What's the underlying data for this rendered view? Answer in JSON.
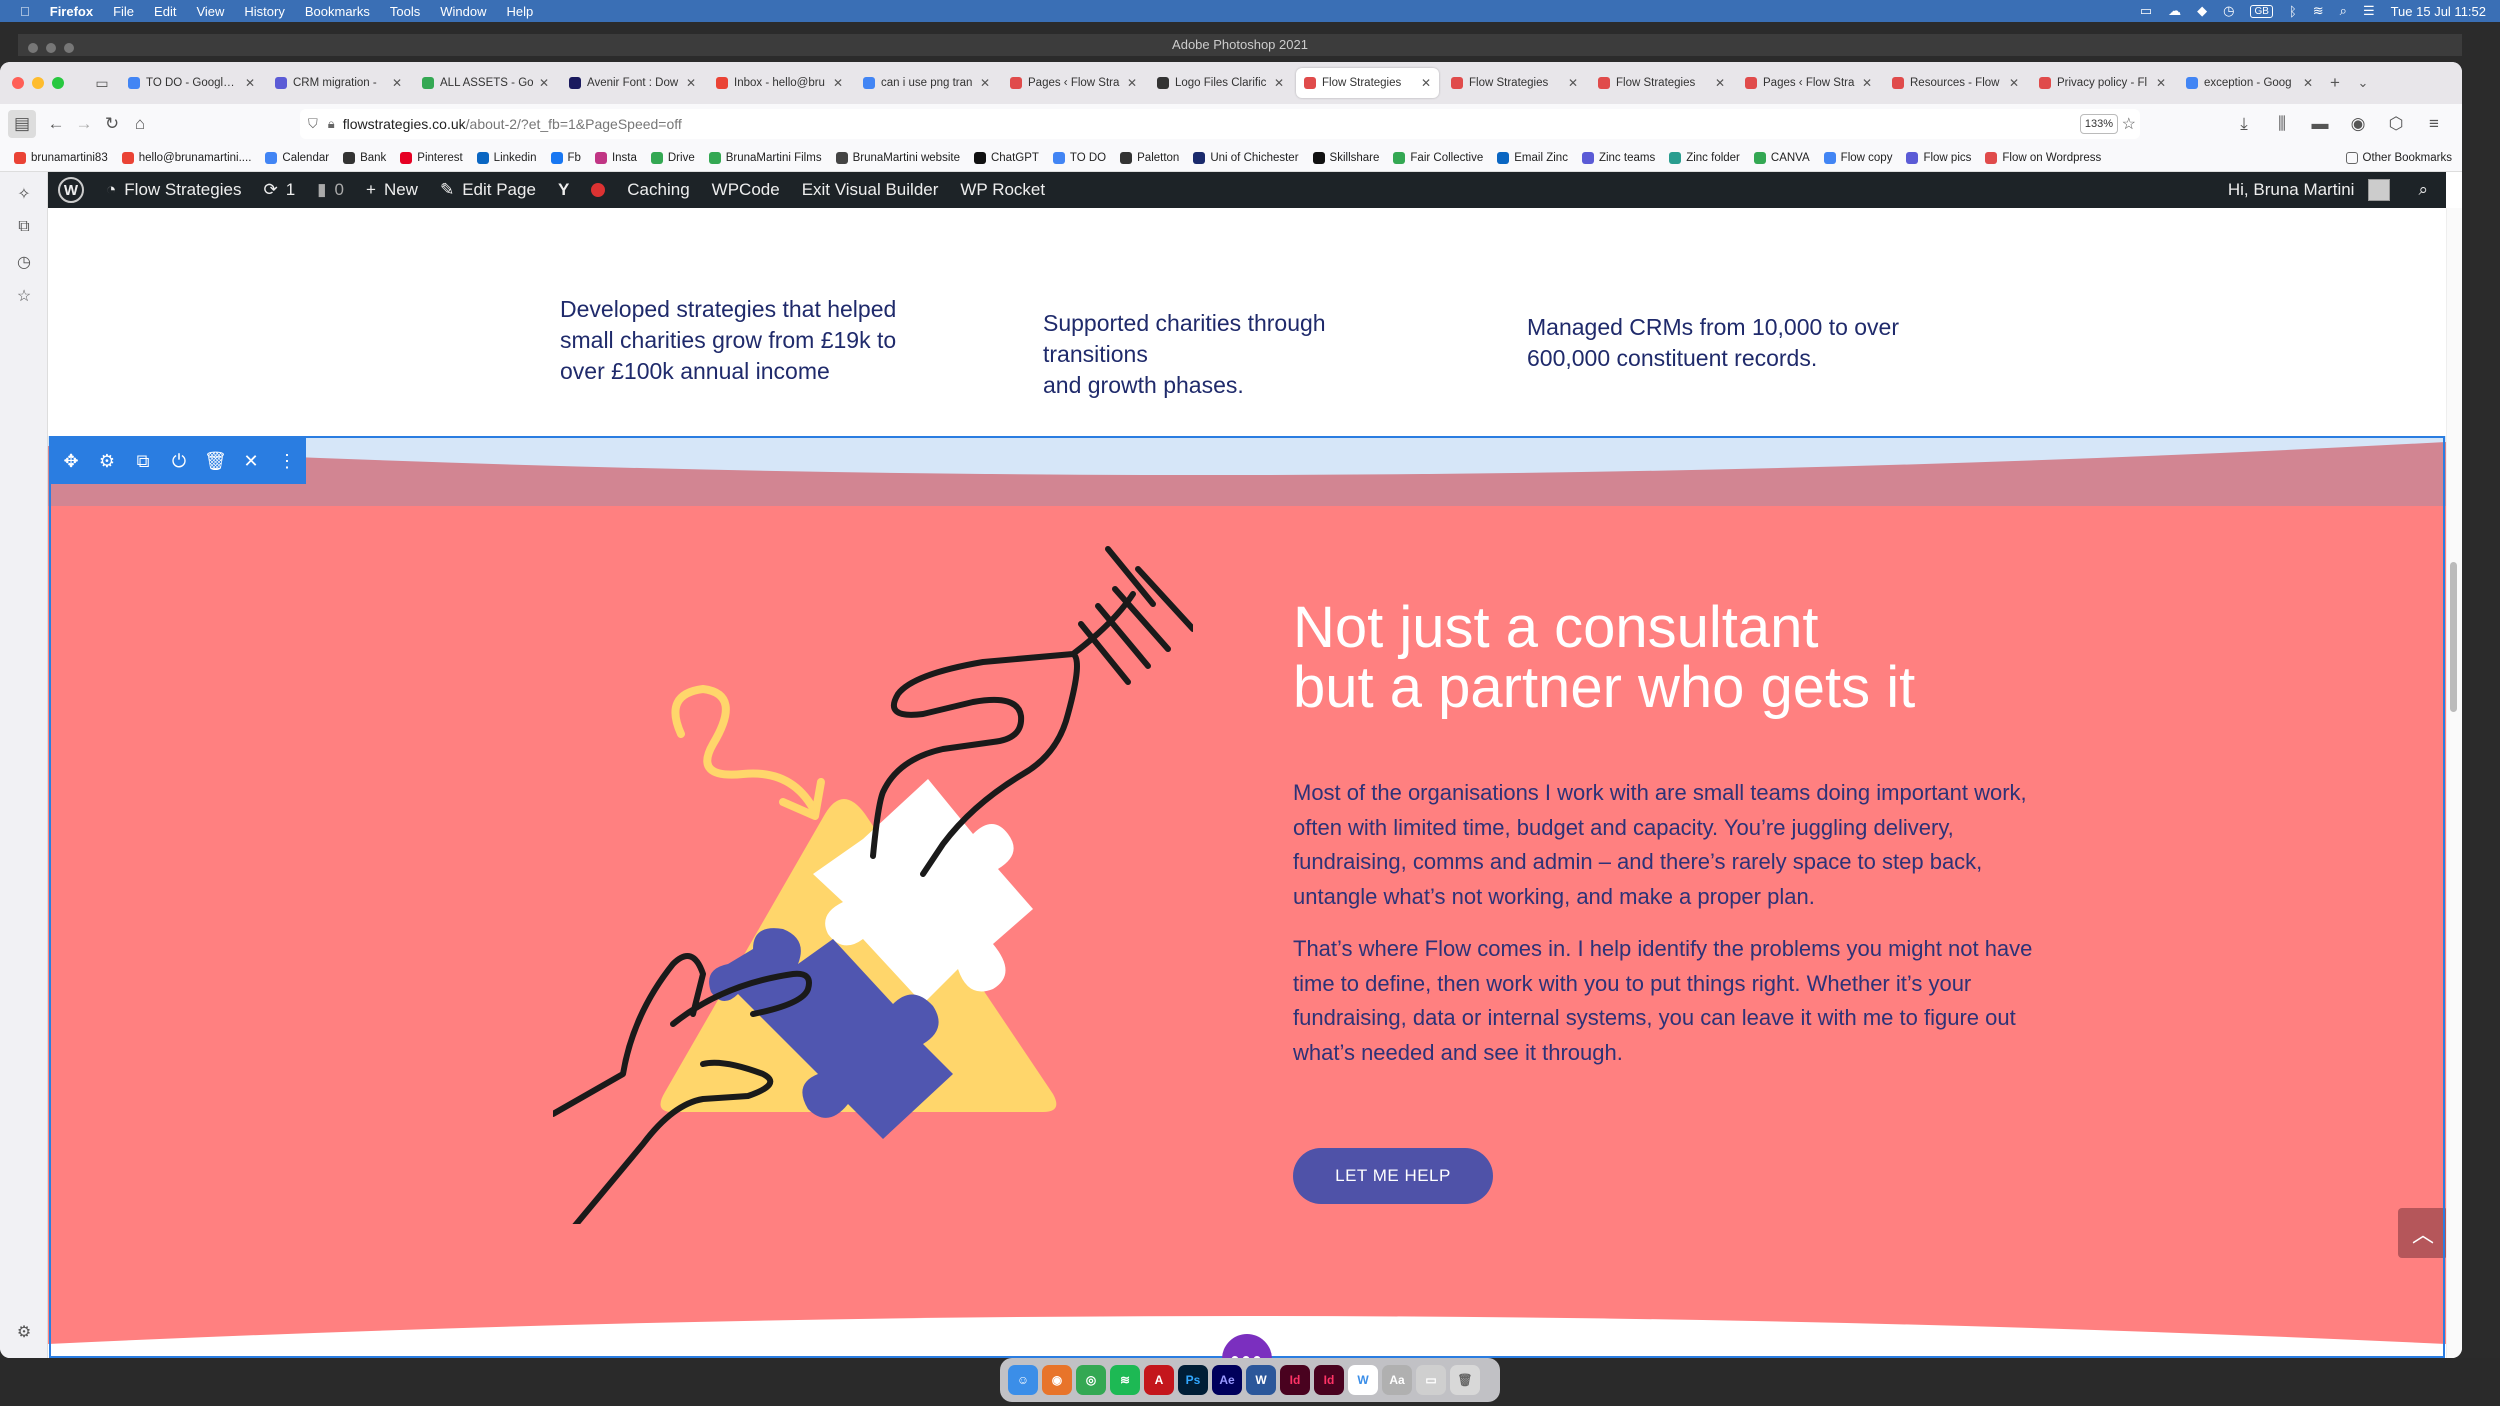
{
  "menubar": {
    "app": "Firefox",
    "items": [
      "File",
      "Edit",
      "View",
      "History",
      "Bookmarks",
      "Tools",
      "Window",
      "Help"
    ],
    "clock": "Tue 15 Jul  11:52",
    "keyboard": "GB"
  },
  "photoshop": {
    "title": "Adobe Photoshop 2021"
  },
  "tabs": [
    {
      "label": "TO DO - Google D",
      "color": "#4285f4"
    },
    {
      "label": "CRM migration - ",
      "color": "#5b5bd6"
    },
    {
      "label": "ALL ASSETS - Go",
      "color": "#34a853"
    },
    {
      "label": "Avenir Font : Dow",
      "color": "#1a1a5e"
    },
    {
      "label": "Inbox - hello@bru",
      "color": "#ea4335"
    },
    {
      "label": "can i use png tran",
      "color": "#4285f4"
    },
    {
      "label": "Pages ‹ Flow Stra",
      "color": "#e04b4b"
    },
    {
      "label": "Logo Files Clarific",
      "color": "#333333"
    },
    {
      "label": "Flow Strategies",
      "color": "#e04b4b",
      "active": true
    },
    {
      "label": "Flow Strategies",
      "color": "#e04b4b"
    },
    {
      "label": "Flow Strategies",
      "color": "#e04b4b"
    },
    {
      "label": "Pages ‹ Flow Stra",
      "color": "#e04b4b"
    },
    {
      "label": "Resources - Flow",
      "color": "#e04b4b"
    },
    {
      "label": "Privacy policy - Fl",
      "color": "#e04b4b"
    },
    {
      "label": "exception - Goog",
      "color": "#4285f4"
    }
  ],
  "url": {
    "domain": "flowstrategies.co.uk",
    "path": "/about-2/?et_fb=1&PageSpeed=off",
    "zoom": "133%"
  },
  "bookmarks": [
    {
      "label": "brunamartini83",
      "color": "#ea4335"
    },
    {
      "label": "hello@brunamartini....",
      "color": "#ea4335"
    },
    {
      "label": "Calendar",
      "color": "#4285f4"
    },
    {
      "label": "Bank",
      "color": "#333333"
    },
    {
      "label": "Pinterest",
      "color": "#e60023"
    },
    {
      "label": "Linkedin",
      "color": "#0a66c2"
    },
    {
      "label": "Fb",
      "color": "#1877f2"
    },
    {
      "label": "Insta",
      "color": "#c13584"
    },
    {
      "label": "Drive",
      "color": "#34a853"
    },
    {
      "label": "BrunaMartini Films",
      "color": "#34a853"
    },
    {
      "label": "BrunaMartini website",
      "color": "#444444"
    },
    {
      "label": "ChatGPT",
      "color": "#111111"
    },
    {
      "label": "TO DO",
      "color": "#4285f4"
    },
    {
      "label": "Paletton",
      "color": "#333333"
    },
    {
      "label": "Uni of Chichester",
      "color": "#1a2a6c"
    },
    {
      "label": "Skillshare",
      "color": "#111111"
    },
    {
      "label": "Fair Collective",
      "color": "#34a853"
    },
    {
      "label": "Email Zinc",
      "color": "#0a66c2"
    },
    {
      "label": "Zinc teams",
      "color": "#5b5bd6"
    },
    {
      "label": "Zinc folder",
      "color": "#2a9d8f"
    },
    {
      "label": "CANVA",
      "color": "#34a853"
    },
    {
      "label": "Flow copy",
      "color": "#4285f4"
    },
    {
      "label": "Flow pics",
      "color": "#5b5bd6"
    },
    {
      "label": "Flow on Wordpress",
      "color": "#e04b4b"
    }
  ],
  "other_bookmarks": "Other Bookmarks",
  "wpbar": {
    "site": "Flow Strategies",
    "updates": "1",
    "comments": "0",
    "new": "New",
    "edit": "Edit Page",
    "caching": "Caching",
    "wpcode": "WPCode",
    "exit": "Exit Visual Builder",
    "rocket": "WP Rocket",
    "greeting": "Hi, Bruna Martini"
  },
  "stats": [
    "Developed strategies that helped\nsmall charities grow from £19k to\nover £100k annual income",
    "Supported charities through\ntransitions\nand growth phases.",
    "Managed CRMs from 10,000 to over\n600,000 constituent records."
  ],
  "section": {
    "heading": "Not just a consultant\nbut a partner who gets it",
    "para1": "Most of the organisations I work with are small teams doing important work, often with limited time, budget and capacity. You’re juggling delivery, fundraising, comms and admin – and there’s rarely space to step back, untangle what’s not working, and make a proper plan.",
    "para2": "That’s where Flow comes in. I help identify the problems you might not have time to define, then work with you to put things right. Whether it’s your fundraising, data or internal systems, you can leave it with me to figure out what’s needed and see it through.",
    "cta": "LET ME HELP",
    "bg": "#ff8080",
    "accent": "#4f52a8",
    "text": "#2d3277"
  },
  "builder": {
    "more": "•••",
    "add": "+"
  }
}
